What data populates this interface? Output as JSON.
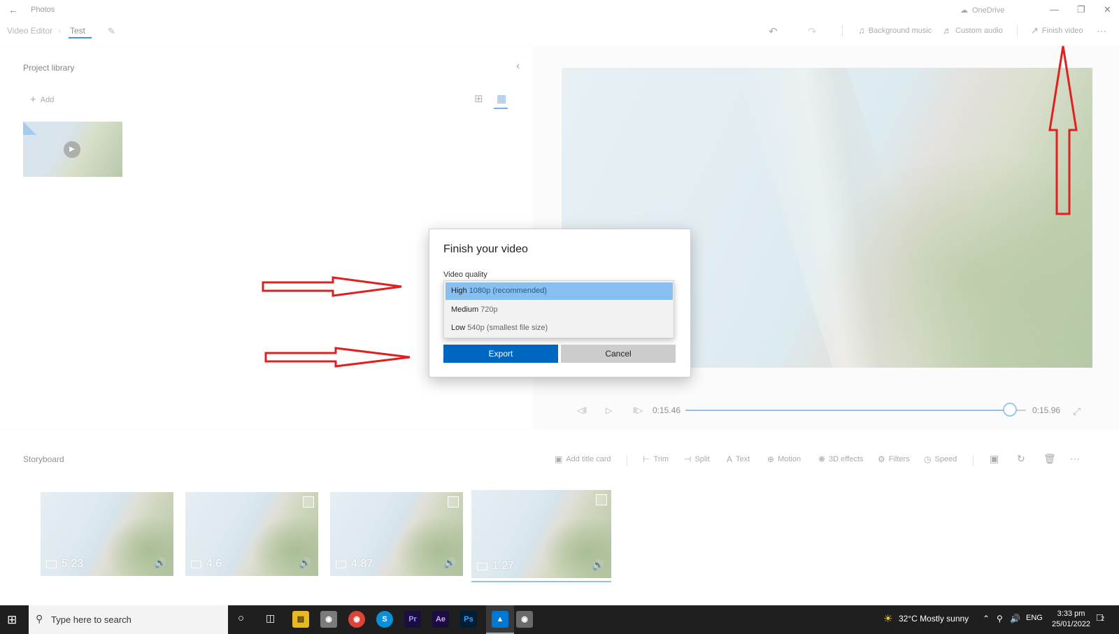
{
  "titlebar": {
    "back_icon": "back-arrow-icon",
    "app_title": "Photos",
    "onedrive_label": "OneDrive"
  },
  "commandbar": {
    "breadcrumb_root": "Video Editor",
    "breadcrumb_project": "Test",
    "background_music": "Background music",
    "custom_audio": "Custom audio",
    "finish_video": "Finish video"
  },
  "library": {
    "title": "Project library",
    "add_label": "Add"
  },
  "player": {
    "current_time": "0:15.46",
    "total_time": "0:15.96",
    "progress_fraction": 0.968
  },
  "storyboard": {
    "title": "Storyboard",
    "tools": {
      "add_title_card": "Add title card",
      "trim": "Trim",
      "split": "Split",
      "text": "Text",
      "motion": "Motion",
      "effects_3d": "3D effects",
      "filters": "Filters",
      "speed": "Speed"
    },
    "clips": [
      {
        "duration": "5.23"
      },
      {
        "duration": "4.6"
      },
      {
        "duration": "4.87"
      },
      {
        "duration": "1.27"
      }
    ]
  },
  "dialog": {
    "title": "Finish your video",
    "quality_label": "Video quality",
    "options": [
      {
        "name": "High",
        "detail": "1080p (recommended)",
        "selected": true
      },
      {
        "name": "Medium",
        "detail": "720p",
        "selected": false
      },
      {
        "name": "Low",
        "detail": "540p (smallest file size)",
        "selected": false
      }
    ],
    "export_label": "Export",
    "cancel_label": "Cancel"
  },
  "taskbar": {
    "search_placeholder": "Type here to search",
    "weather": "32°C  Mostly sunny",
    "language": "ENG",
    "time": "3:33 pm",
    "date": "25/01/2022",
    "notification_count": "2"
  },
  "colors": {
    "accent": "#0067c0",
    "selection": "#86bff0",
    "annotation_arrow": "#e02020",
    "taskbar": "#1f1f1f"
  }
}
